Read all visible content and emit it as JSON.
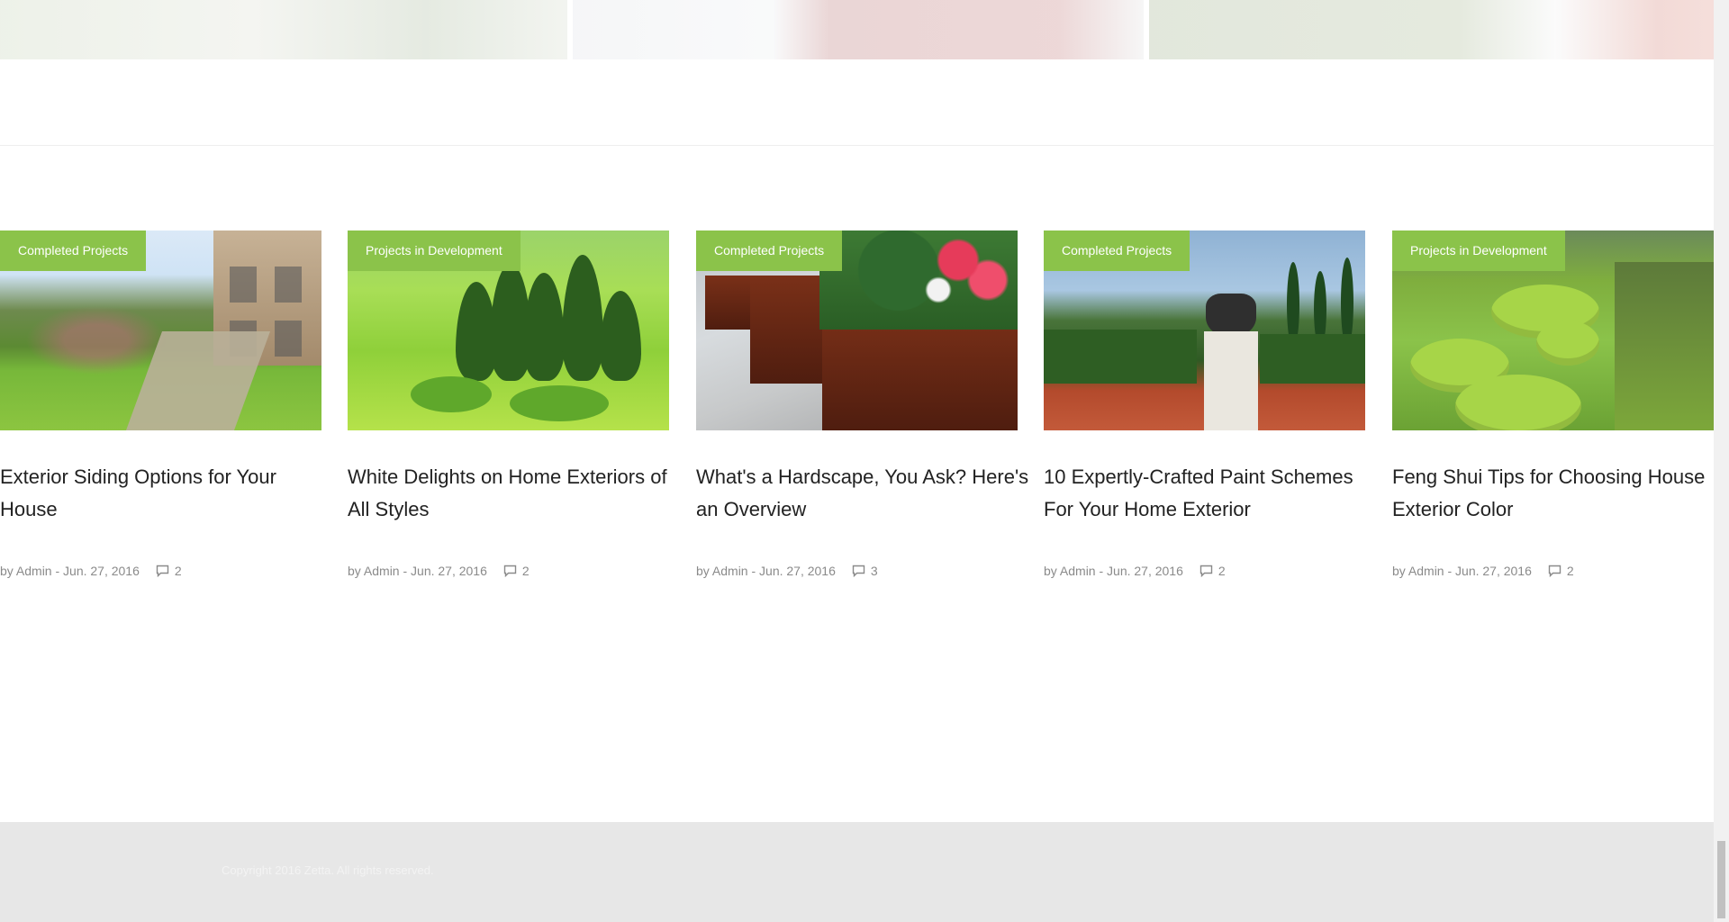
{
  "posts": [
    {
      "category": "Completed Projects",
      "title": "Exterior Siding Options for Your House",
      "byline": "by Admin - Jun. 27, 2016",
      "comments": "2"
    },
    {
      "category": "Projects in Development",
      "title": "White Delights on Home Exteriors of All Styles",
      "byline": "by Admin - Jun. 27, 2016",
      "comments": "2"
    },
    {
      "category": "Completed Projects",
      "title": "What's a Hardscape, You Ask? Here's an Overview",
      "byline": "by Admin - Jun. 27, 2016",
      "comments": "3"
    },
    {
      "category": "Completed Projects",
      "title": "10 Expertly-Crafted Paint Schemes For Your Home Exterior",
      "byline": "by Admin - Jun. 27, 2016",
      "comments": "2"
    },
    {
      "category": "Projects in Development",
      "title": "Feng Shui Tips for Choosing House Exterior Color",
      "byline": "by Admin - Jun. 27, 2016",
      "comments": "2"
    }
  ],
  "footer": {
    "copyright": "Copyright 2016 Zetta. All rights reserved."
  },
  "colors": {
    "accent": "#8bc34a",
    "footer_bg": "#e7e7e7"
  }
}
